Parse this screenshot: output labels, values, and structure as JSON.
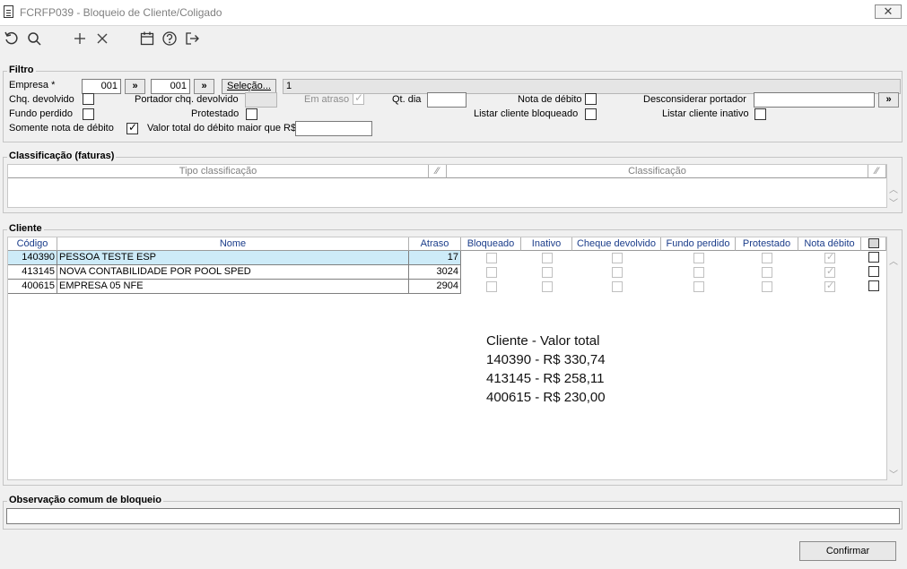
{
  "window": {
    "title": "FCRFP039 - Bloqueio de Cliente/Coligado",
    "close_icon": "close-icon"
  },
  "toolbar": {
    "icons": [
      "refresh-icon",
      "search-icon",
      "add-icon",
      "delete-icon",
      "calendar-icon",
      "help-icon",
      "exit-icon"
    ]
  },
  "filtro": {
    "label": "Filtro",
    "empresa_label": "Empresa *",
    "empresa_from": "001",
    "empresa_to": "001",
    "arrow_btn": "»",
    "selecao_btn": "Seleção...",
    "selecao_value": "1",
    "chq_devolvido_label": "Chq. devolvido",
    "portador_label": "Portador chq. devolvido",
    "em_atraso_label": "Em atraso",
    "qt_dia_label": "Qt. dia",
    "nota_debito_label": "Nota de débito",
    "desconsiderar_label": "Desconsiderar portador",
    "fundo_perdido_label": "Fundo perdido",
    "protestado_label": "Protestado",
    "listar_bloqueado_label": "Listar cliente bloqueado",
    "listar_inativo_label": "Listar cliente inativo",
    "somente_nota_label": "Somente nota de débito",
    "valor_total_label": "Valor total do débito maior que R$",
    "check_mark": "✓"
  },
  "classificacao": {
    "label": "Classificação (faturas)",
    "col_tipo": "Tipo classificação",
    "col_class": "Classificação"
  },
  "cliente": {
    "label": "Cliente",
    "columns": [
      "Código",
      "Nome",
      "Atraso",
      "Bloqueado",
      "Inativo",
      "Cheque devolvido",
      "Fundo perdido",
      "Protestado",
      "Nota débito"
    ],
    "rows": [
      {
        "codigo": "140390",
        "nome": "PESSOA TESTE ESP",
        "atraso": "17"
      },
      {
        "codigo": "413145",
        "nome": "NOVA CONTABILIDADE POR POOL SPED",
        "atraso": "3024"
      },
      {
        "codigo": "400615",
        "nome": "EMPRESA 05 NFE",
        "atraso": "2904"
      }
    ],
    "summary": [
      "Cliente - Valor total",
      "140390 - R$ 330,74",
      "413145 - R$ 258,11",
      "400615 - R$ 230,00"
    ]
  },
  "observacao": {
    "label": "Observação comum de bloqueio"
  },
  "footer": {
    "confirmar_btn": "Confirmar"
  }
}
